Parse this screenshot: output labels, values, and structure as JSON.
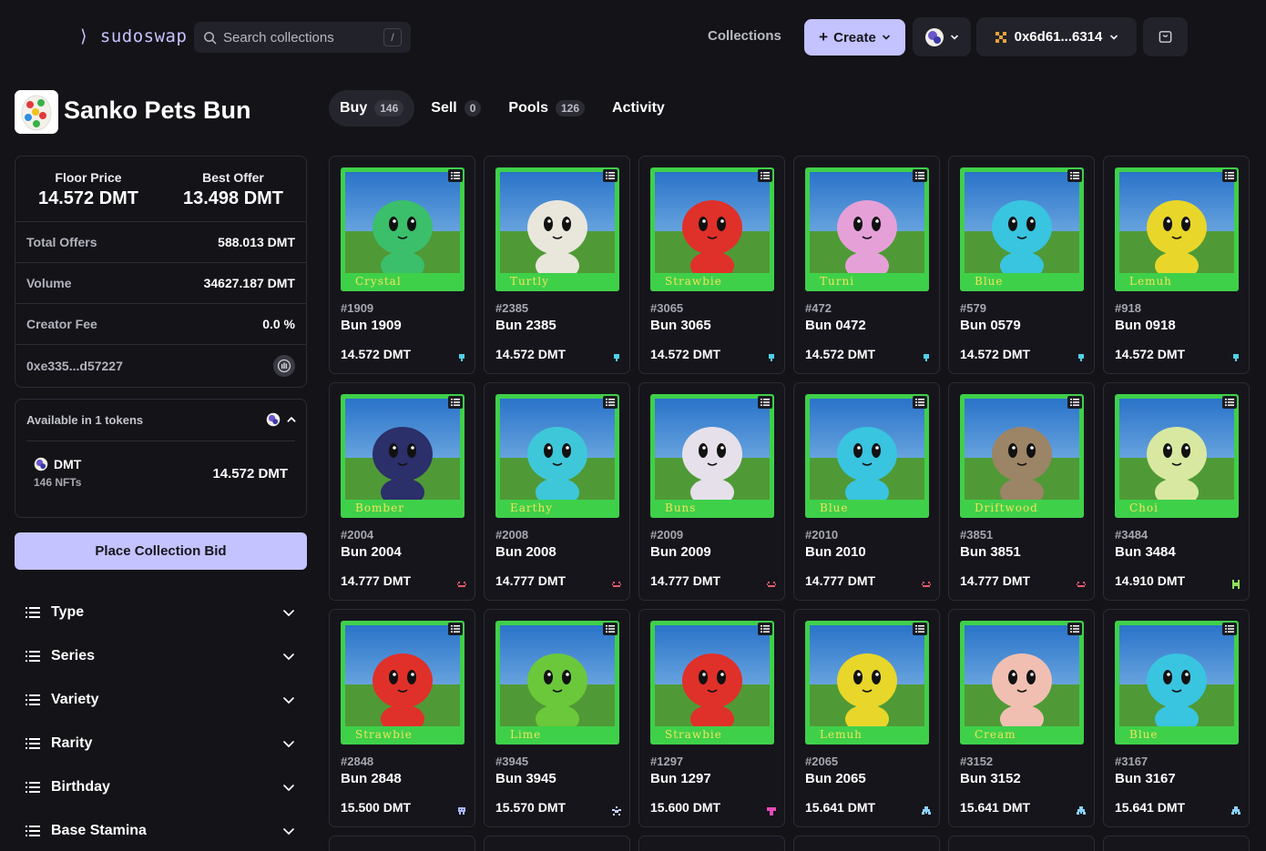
{
  "header": {
    "logo": "⟩ sudoswap ⟨",
    "search_placeholder": "Search collections",
    "search_shortcut": "/",
    "nav_collections": "Collections",
    "create_label": "Create",
    "wallet_address": "0x6d61...6314"
  },
  "collection": {
    "name": "Sanko Pets Bun",
    "floor_label": "Floor Price",
    "floor_value": "14.572 DMT",
    "offer_label": "Best Offer",
    "offer_value": "13.498 DMT",
    "rows": [
      {
        "label": "Total Offers",
        "value": "588.013 DMT"
      },
      {
        "label": "Volume",
        "value": "34627.187 DMT"
      },
      {
        "label": "Creator Fee",
        "value": "0.0 %"
      }
    ],
    "contract": "0xe335...d57227"
  },
  "tokens": {
    "header": "Available in 1 tokens",
    "name": "DMT",
    "count": "146 NFTs",
    "value": "14.572 DMT"
  },
  "bid_button": "Place Collection Bid",
  "filters": [
    "Type",
    "Series",
    "Variety",
    "Rarity",
    "Birthday",
    "Base Stamina"
  ],
  "tabs": [
    {
      "label": "Buy",
      "count": "146"
    },
    {
      "label": "Sell",
      "count": "0"
    },
    {
      "label": "Pools",
      "count": "126"
    },
    {
      "label": "Activity",
      "count": ""
    }
  ],
  "colors": {
    "accent": "#c4c2ff",
    "background": "#131318",
    "panel_border": "#2c2c35"
  },
  "nfts": [
    {
      "num": "#1909",
      "name": "Bun 1909",
      "price": "14.572 DMT",
      "label": "Crystal",
      "body": "#3bbf6a",
      "badge": "#4fd1e8",
      "badge_icon": "paw"
    },
    {
      "num": "#2385",
      "name": "Bun 2385",
      "price": "14.572 DMT",
      "label": "Turtly",
      "body": "#e9e6dc",
      "badge": "#4fd1e8",
      "badge_icon": "paw"
    },
    {
      "num": "#3065",
      "name": "Bun 3065",
      "price": "14.572 DMT",
      "label": "Strawbie",
      "body": "#e0302a",
      "badge": "#4fd1e8",
      "badge_icon": "paw"
    },
    {
      "num": "#472",
      "name": "Bun 0472",
      "price": "14.572 DMT",
      "label": "Turni",
      "body": "#e5a0d8",
      "badge": "#4fd1e8",
      "badge_icon": "paw"
    },
    {
      "num": "#579",
      "name": "Bun 0579",
      "price": "14.572 DMT",
      "label": "Blue",
      "body": "#39c4e0",
      "badge": "#4fd1e8",
      "badge_icon": "paw"
    },
    {
      "num": "#918",
      "name": "Bun 0918",
      "price": "14.572 DMT",
      "label": "Lemuh",
      "body": "#e8d62a",
      "badge": "#4fd1e8",
      "badge_icon": "paw"
    },
    {
      "num": "#2004",
      "name": "Bun 2004",
      "price": "14.777 DMT",
      "label": "Bomber",
      "body": "#2b2f6a",
      "badge": "#e65a6a",
      "badge_icon": "face"
    },
    {
      "num": "#2008",
      "name": "Bun 2008",
      "price": "14.777 DMT",
      "label": "Earthy",
      "body": "#3ec7d8",
      "badge": "#e65a6a",
      "badge_icon": "face"
    },
    {
      "num": "#2009",
      "name": "Bun 2009",
      "price": "14.777 DMT",
      "label": "Buns",
      "body": "#e6e0ea",
      "badge": "#e65a6a",
      "badge_icon": "face"
    },
    {
      "num": "#2010",
      "name": "Bun 2010",
      "price": "14.777 DMT",
      "label": "Blue",
      "body": "#39c4e0",
      "badge": "#e65a6a",
      "badge_icon": "face"
    },
    {
      "num": "#3851",
      "name": "Bun 3851",
      "price": "14.777 DMT",
      "label": "Driftwood",
      "body": "#9c8466",
      "badge": "#e65a6a",
      "badge_icon": "face"
    },
    {
      "num": "#3484",
      "name": "Bun 3484",
      "price": "14.910 DMT",
      "label": "Choi",
      "body": "#d9e8a0",
      "badge": "#8ee05a",
      "badge_icon": "alien"
    },
    {
      "num": "#2848",
      "name": "Bun 2848",
      "price": "15.500 DMT",
      "label": "Strawbie",
      "body": "#e0302a",
      "badge": "#a9b7ff",
      "badge_icon": "robot"
    },
    {
      "num": "#3945",
      "name": "Bun 3945",
      "price": "15.570 DMT",
      "label": "Lime",
      "body": "#6bc83a",
      "badge": "#c7d3ff",
      "badge_icon": "bug"
    },
    {
      "num": "#1297",
      "name": "Bun 1297",
      "price": "15.600 DMT",
      "label": "Strawbie",
      "body": "#e0302a",
      "badge": "#e64ab9",
      "badge_icon": "mushroom"
    },
    {
      "num": "#2065",
      "name": "Bun 2065",
      "price": "15.641 DMT",
      "label": "Lemuh",
      "body": "#e8d62a",
      "badge": "#8ad3ff",
      "badge_icon": "ghost"
    },
    {
      "num": "#3152",
      "name": "Bun 3152",
      "price": "15.641 DMT",
      "label": "Cream",
      "body": "#f0bfb2",
      "badge": "#8ad3ff",
      "badge_icon": "ghost"
    },
    {
      "num": "#3167",
      "name": "Bun 3167",
      "price": "15.641 DMT",
      "label": "Blue",
      "body": "#39c4e0",
      "badge": "#8ad3ff",
      "badge_icon": "ghost"
    }
  ]
}
